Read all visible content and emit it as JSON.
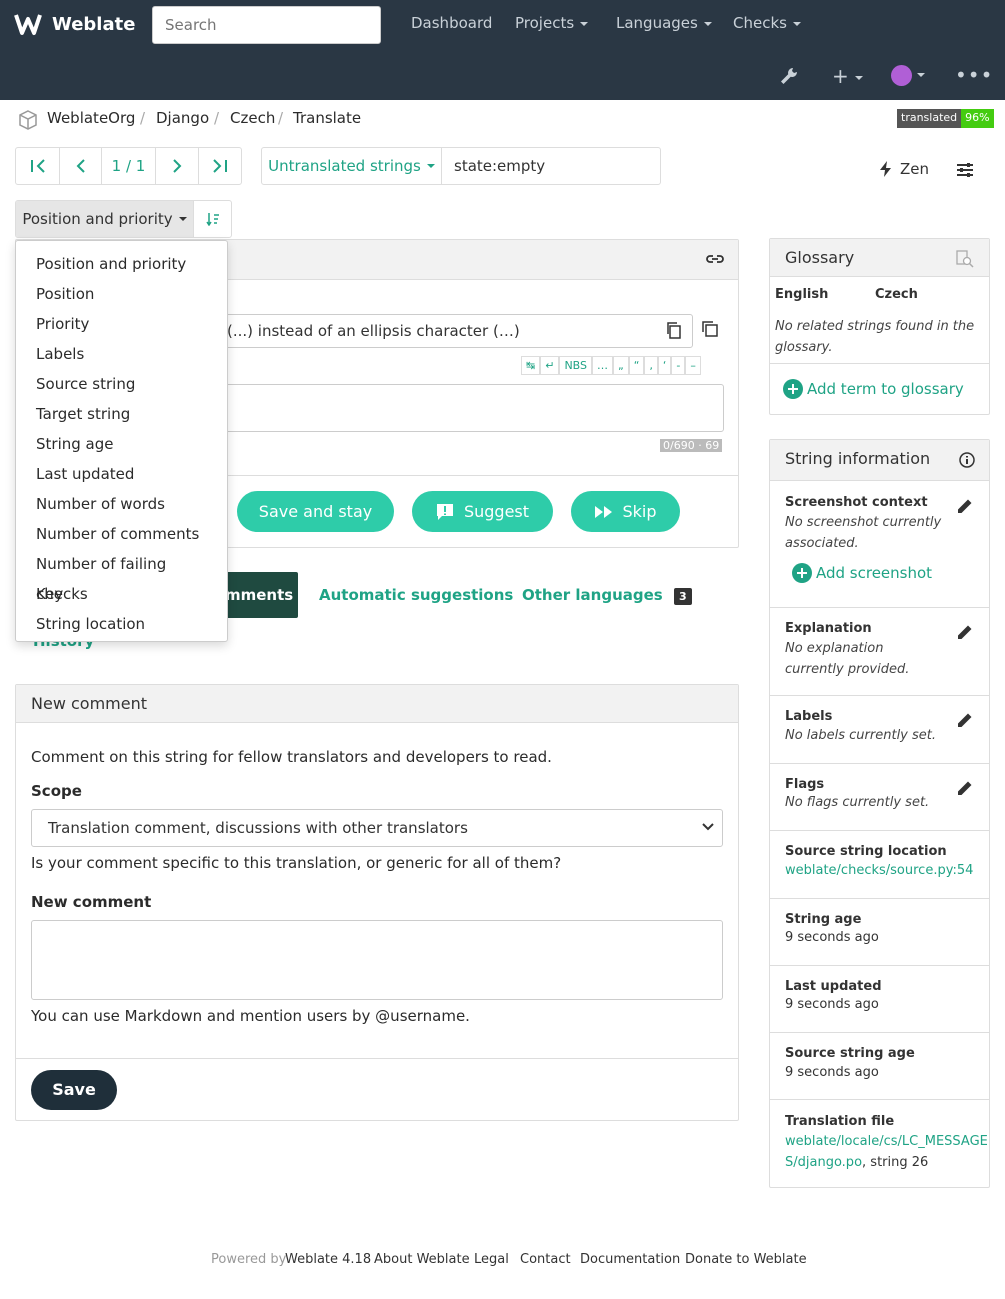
{
  "nav": {
    "brand": "Weblate",
    "search_placeholder": "Search",
    "links": [
      "Dashboard",
      "Projects",
      "Languages",
      "Checks"
    ]
  },
  "breadcrumb": [
    "WeblateOrg",
    "Django",
    "Czech",
    "Translate"
  ],
  "badge": {
    "label": "translated",
    "value": "96%"
  },
  "pager": {
    "position": "1 / 1"
  },
  "filter": {
    "dropdown": "Untranslated strings",
    "query": "state:empty"
  },
  "zen": "Zen",
  "sort": {
    "label": "Position and priority",
    "options": [
      "Position and priority",
      "Position",
      "Priority",
      "Labels",
      "Source string",
      "Target string",
      "String age",
      "Last updated",
      "Number of words",
      "Number of comments",
      "Number of failing checks",
      "Key",
      "String location"
    ]
  },
  "editor": {
    "source_text": "(...) instead of an ellipsis character (…)",
    "special_chars": [
      "↹",
      "↵",
      "NBS",
      "…",
      "„",
      "“",
      "‚",
      "‘",
      "-",
      "–"
    ],
    "counter": "0/690 · 69",
    "save_stay": "Save and stay",
    "suggest": "Suggest",
    "skip": "Skip"
  },
  "tabs": {
    "comments": "mments",
    "auto": "Automatic suggestions",
    "other": "Other languages",
    "other_count": "3",
    "history": "History"
  },
  "comment": {
    "title": "New comment",
    "intro": "Comment on this string for fellow translators and developers to read.",
    "scope_label": "Scope",
    "scope_value": "Translation comment, discussions with other translators",
    "scope_help": "Is your comment specific to this translation, or generic for all of them?",
    "new_label": "New comment",
    "markdown_help": "You can use Markdown and mention users by @username.",
    "save": "Save"
  },
  "glossary": {
    "title": "Glossary",
    "col_en": "English",
    "col_cs": "Czech",
    "empty": "No related strings found in the glossary.",
    "add": "Add term to glossary"
  },
  "info": {
    "title": "String information",
    "screenshot_label": "Screenshot context",
    "screenshot_value": "No screenshot currently associated.",
    "add_screenshot": "Add screenshot",
    "explanation_label": "Explanation",
    "explanation_value": "No explanation currently provided.",
    "labels_label": "Labels",
    "labels_value": "No labels currently set.",
    "flags_label": "Flags",
    "flags_value": "No flags currently set.",
    "location_label": "Source string location",
    "location_value": "weblate/checks/source.py:54",
    "age_label": "String age",
    "age_value": "9 seconds ago",
    "updated_label": "Last updated",
    "updated_value": "9 seconds ago",
    "source_age_label": "Source string age",
    "source_age_value": "9 seconds ago",
    "file_label": "Translation file",
    "file_value1": "weblate/locale/cs/LC_MESSAGE",
    "file_value2": "S/django.po",
    "file_suffix": ", string 26"
  },
  "footer": {
    "powered": "Powered by",
    "version": "Weblate 4.18",
    "links": [
      "About Weblate",
      "Legal",
      "Contact",
      "Documentation",
      "Donate to Weblate"
    ]
  },
  "colors": {
    "navbar": "#2a3744",
    "accent": "#1fa385",
    "button": "#2ecca9",
    "dark": "#1f2f3a"
  }
}
